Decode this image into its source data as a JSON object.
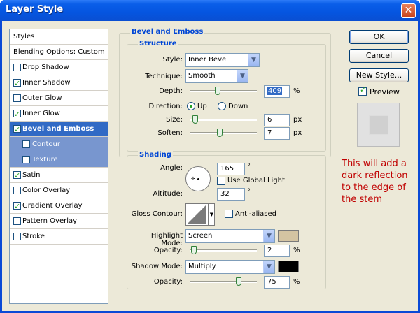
{
  "window": {
    "title": "Layer Style",
    "close_glyph": "✕"
  },
  "styles_list": {
    "header": "Styles",
    "blending": "Blending Options: Custom",
    "items": [
      {
        "label": "Drop Shadow",
        "checked": false
      },
      {
        "label": "Inner Shadow",
        "checked": true
      },
      {
        "label": "Outer Glow",
        "checked": false
      },
      {
        "label": "Inner Glow",
        "checked": true
      },
      {
        "label": "Bevel and Emboss",
        "checked": true,
        "selected": true
      },
      {
        "label": "Contour",
        "checked": false,
        "sub": true
      },
      {
        "label": "Texture",
        "checked": false,
        "sub": true
      },
      {
        "label": "Satin",
        "checked": true
      },
      {
        "label": "Color Overlay",
        "checked": false
      },
      {
        "label": "Gradient Overlay",
        "checked": true
      },
      {
        "label": "Pattern Overlay",
        "checked": false
      },
      {
        "label": "Stroke",
        "checked": false
      }
    ]
  },
  "bevel": {
    "group_title": "Bevel and Emboss",
    "structure_title": "Structure",
    "style_label": "Style:",
    "style_value": "Inner Bevel",
    "technique_label": "Technique:",
    "technique_value": "Smooth",
    "depth_label": "Depth:",
    "depth_value": "409",
    "depth_unit": "%",
    "depth_level": 0.41,
    "direction_label": "Direction:",
    "dir_up": "Up",
    "dir_down": "Down",
    "direction_value": "Up",
    "size_label": "Size:",
    "size_value": "6",
    "size_unit": "px",
    "size_level": 0.04,
    "soften_label": "Soften:",
    "soften_value": "7",
    "soften_unit": "px",
    "soften_level": 0.44
  },
  "shading": {
    "title": "Shading",
    "angle_label": "Angle:",
    "angle_value": "165",
    "angle_unit": "°",
    "global_light_label": "Use Global Light",
    "global_light_checked": false,
    "altitude_label": "Altitude:",
    "altitude_value": "32",
    "altitude_unit": "°",
    "gloss_label": "Gloss Contour:",
    "anti_alias_label": "Anti-aliased",
    "anti_alias_checked": false,
    "highlight_label": "Highlight Mode:",
    "highlight_value": "Screen",
    "highlight_color": "#d4c4a2",
    "h_opacity_label": "Opacity:",
    "h_opacity_value": "2",
    "h_opacity_unit": "%",
    "h_opacity_level": 0.02,
    "shadow_label": "Shadow Mode:",
    "shadow_value": "Multiply",
    "shadow_color": "#000000",
    "s_opacity_label": "Opacity:",
    "s_opacity_value": "75",
    "s_opacity_unit": "%",
    "s_opacity_level": 0.75
  },
  "buttons": {
    "ok": "OK",
    "cancel": "Cancel",
    "new_style": "New Style...",
    "preview": "Preview",
    "preview_checked": true
  },
  "annotation": "This will add a dark reflection to the edge of the stem"
}
